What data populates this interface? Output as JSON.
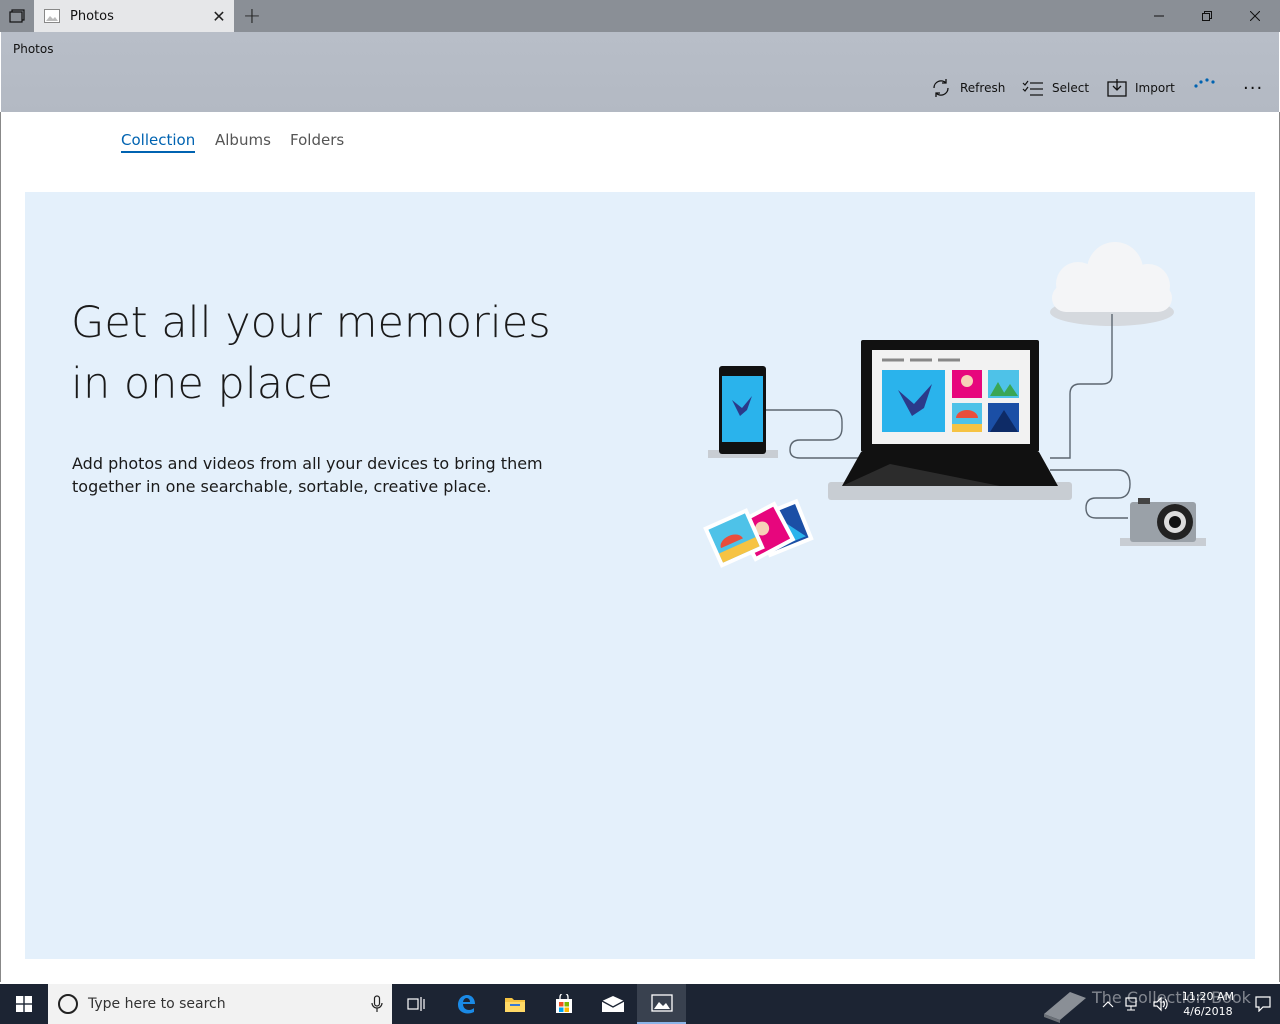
{
  "window": {
    "tab_title": "Photos",
    "new_tab_symbol": "+",
    "close_tab_symbol": "✕"
  },
  "header": {
    "app_title": "Photos",
    "commands": [
      {
        "label": "Refresh",
        "icon": "refresh-icon"
      },
      {
        "label": "Select",
        "icon": "select-icon"
      },
      {
        "label": "Import",
        "icon": "import-icon"
      }
    ],
    "more_symbol": "···"
  },
  "nav": {
    "tabs": [
      {
        "label": "Collection",
        "active": true
      },
      {
        "label": "Albums",
        "active": false
      },
      {
        "label": "Folders",
        "active": false
      }
    ]
  },
  "hero": {
    "headline": "Get all your memories in one place",
    "subtext": "Add photos and videos from all your devices to bring them together in one searchable, sortable, creative place."
  },
  "taskbar": {
    "search_placeholder": "Type here to search",
    "time": "11:20 AM",
    "date": "4/6/2018",
    "watermark": "The Collection Book"
  },
  "colors": {
    "accent": "#0063b1",
    "hero_bg": "#e4f0fb",
    "taskbar": "#1c2433"
  }
}
